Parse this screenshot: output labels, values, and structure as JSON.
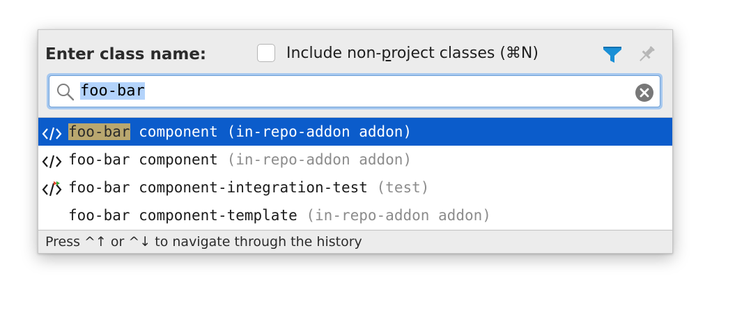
{
  "dialog": {
    "title": "Enter class name:",
    "include_label_pre": "Include non-",
    "include_label_mnemonic": "p",
    "include_label_post": "roject classes (⌘N)",
    "include_checked": false,
    "filter_icon": "filter-icon",
    "pin_icon": "pin-icon"
  },
  "search": {
    "value": "foo-bar",
    "icon": "search-icon",
    "clear_icon": "clear-icon"
  },
  "results": [
    {
      "match": "foo-bar",
      "kind": " component ",
      "location": "(in-repo-addon addon)",
      "icon": "code-tag-icon",
      "selected": true
    },
    {
      "match": "foo-bar",
      "kind": " component ",
      "location": "(in-repo-addon addon)",
      "icon": "code-tag-icon",
      "selected": false
    },
    {
      "match": "foo-bar",
      "kind": " component-integration-test ",
      "location": "(test)",
      "icon": "code-tag-test-icon",
      "selected": false
    },
    {
      "match": "foo-bar",
      "kind": " component-template ",
      "location": "(in-repo-addon addon)",
      "icon": "",
      "selected": false
    }
  ],
  "footer": {
    "hint": "Press ^↑ or ^↓ to navigate through the history"
  },
  "colors": {
    "selection": "#0b5ccb",
    "match_highlight": "#b9a76f",
    "filter_icon": "#1a8fd6"
  }
}
